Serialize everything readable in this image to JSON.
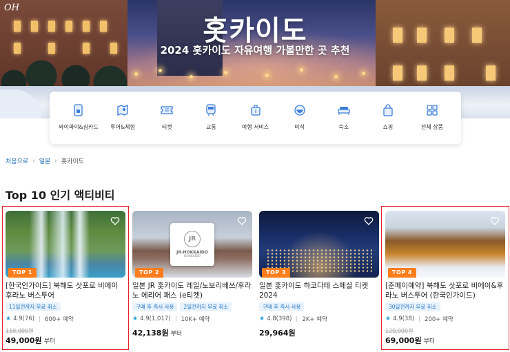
{
  "hero": {
    "signature": "OH",
    "title": "홋카이도",
    "subtitle": "2024 홋카이도 자유여행 가볼만한 곳 추천"
  },
  "categories": [
    {
      "label": "와이파이&심카드",
      "icon": "sim-card-icon"
    },
    {
      "label": "투어&체험",
      "icon": "map-tour-icon"
    },
    {
      "label": "티켓",
      "icon": "ticket-icon"
    },
    {
      "label": "교통",
      "icon": "train-icon"
    },
    {
      "label": "여행 서비스",
      "icon": "luggage-icon"
    },
    {
      "label": "미식",
      "icon": "dish-icon"
    },
    {
      "label": "숙소",
      "icon": "bed-icon"
    },
    {
      "label": "쇼핑",
      "icon": "shopping-bag-icon"
    },
    {
      "label": "전체 상품",
      "icon": "grid-icon"
    }
  ],
  "breadcrumb": {
    "home": "처음으로",
    "country": "일본",
    "current": "홋카이도",
    "separator": "›"
  },
  "section_title": "Top 10 인기 액티비티",
  "cards": [
    {
      "badge": "TOP 1",
      "title": "[한국인가이드] 북해도 삿포로 비에이 후라노 버스투어",
      "tags": [
        "11일전까지 무료 취소"
      ],
      "rating": "4.9(76)",
      "bookings": "600+ 예약",
      "old_price": "110,000원",
      "price": "49,000원",
      "price_suffix": "부터"
    },
    {
      "badge": "TOP 2",
      "title": "일본 JR 홋카이도 레일/노보리베쓰/후라노 에리어 패스 (e티켓)",
      "tags": [
        "구매 후 즉시 사용",
        "2일전까지 무료 취소"
      ],
      "rating": "4.9(1,017)",
      "bookings": "10K+ 예약",
      "old_price": "",
      "price": "42,138원",
      "price_suffix": "부터",
      "logo_text": "JR",
      "logo_line1": "JR-HOKKAIDO",
      "logo_line2": "HOKKAIDO"
    },
    {
      "badge": "TOP 3",
      "title": "일본 홋카이도 하코다테 스페셜 티켓 2024",
      "tags": [
        "구매 후 즉시 사용"
      ],
      "rating": "4.8(398)",
      "bookings": "2K+ 예약",
      "old_price": "",
      "price": "29,964원",
      "price_suffix": ""
    },
    {
      "badge": "TOP 4",
      "title": "[준페이예약] 북해도 삿포로 비에이&후라노 버스투어 (한국인가이드)",
      "tags": [
        "30일전까지 무료 취소"
      ],
      "rating": "4.9(38)",
      "bookings": "200+ 예약",
      "old_price": "120,000원",
      "price": "69,000원",
      "price_suffix": "부터"
    }
  ],
  "colors": {
    "badge": "#ff7d1a",
    "tag_text": "#1f74c4",
    "star": "#1a9ad6",
    "highlight": "#e5242b"
  }
}
